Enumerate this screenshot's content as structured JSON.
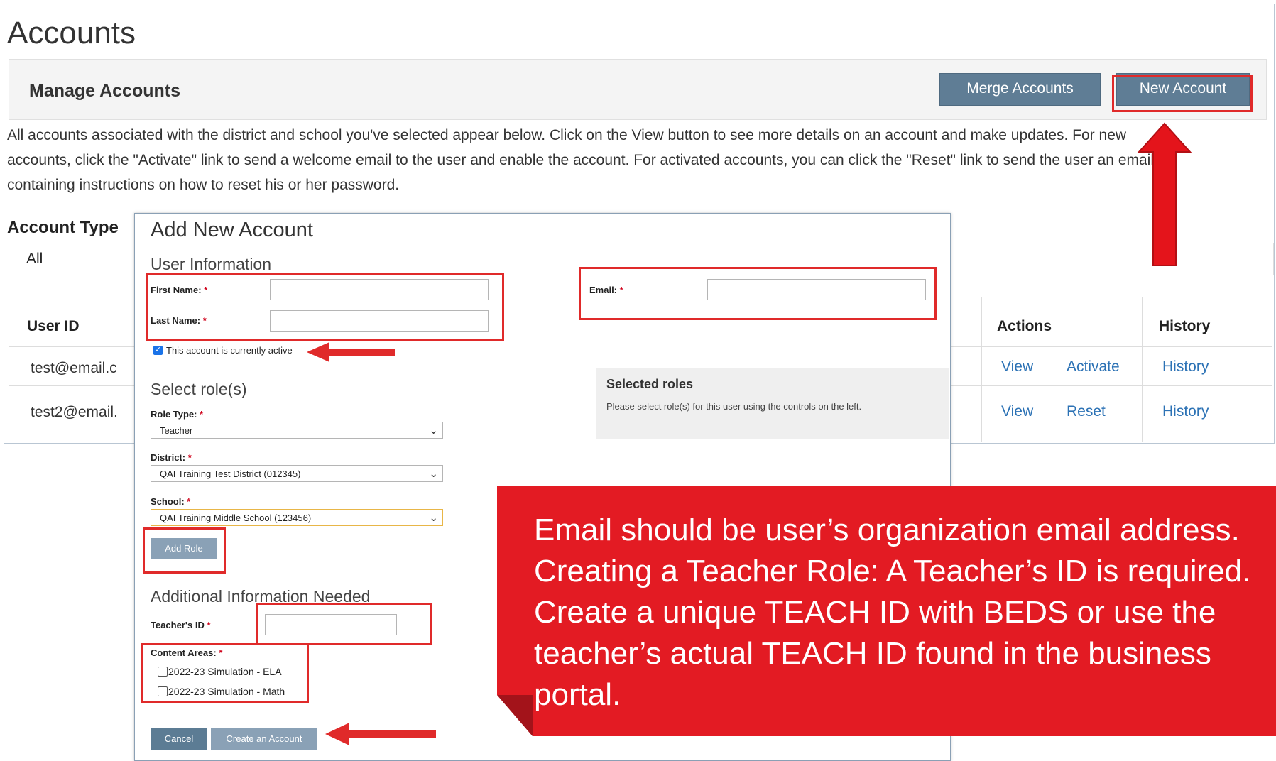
{
  "page": {
    "title": "Accounts",
    "manage_title": "Manage Accounts",
    "merge_button": "Merge Accounts",
    "new_button": "New Account",
    "description_lines": [
      "All accounts associated with the district and school you've selected appear below. Click on the View button to see more details on an account and make updates. For new",
      "accounts, click the \"Activate\" link to send a welcome email to the user and enable the account. For activated accounts, you can click the \"Reset\" link to send the user an email",
      "containing instructions on how to reset his or her password."
    ],
    "account_type_label": "Account Type",
    "account_type_value": "All"
  },
  "table": {
    "headers": {
      "user_id": "User ID",
      "actions": "Actions",
      "history": "History"
    },
    "rows": [
      {
        "user_id": "test@email.c",
        "view": "View",
        "action": "Activate",
        "history": "History"
      },
      {
        "user_id": "test2@email.",
        "view": "View",
        "action": "Reset",
        "history": "History"
      }
    ]
  },
  "modal": {
    "title": "Add New Account",
    "user_info_heading": "User Information",
    "first_name_label": "First Name:",
    "last_name_label": "Last Name:",
    "email_label": "Email:",
    "required_mark": "*",
    "active_checkbox_label": "This account is currently active",
    "select_roles_heading": "Select role(s)",
    "role_type_label": "Role Type:",
    "role_type_value": "Teacher",
    "district_label": "District:",
    "district_value": "QAI Training Test District (012345)",
    "school_label": "School:",
    "school_value": "QAI Training Middle School (123456)",
    "add_role_button": "Add Role",
    "selected_roles_heading": "Selected roles",
    "selected_roles_text": "Please select role(s) for this user using the controls on the left.",
    "additional_heading": "Additional Information Needed",
    "teacher_id_label": "Teacher's ID",
    "content_areas_label": "Content Areas:",
    "content_areas": [
      "2022-23 Simulation - ELA",
      "2022-23 Simulation - Math"
    ],
    "cancel_button": "Cancel",
    "create_button": "Create an Account"
  },
  "callout": {
    "lines": [
      "Email should be user’s organization email address.",
      "Creating a Teacher Role:  A Teacher’s ID is required.",
      "Create a unique TEACH ID with BEDS or use the",
      "teacher’s actual TEACH ID found in the business",
      "portal."
    ]
  },
  "colors": {
    "annotation_red": "#e02a2a",
    "callout_red": "#e31b23",
    "button_slate": "#5f7d95",
    "link_blue": "#2c72b5"
  }
}
